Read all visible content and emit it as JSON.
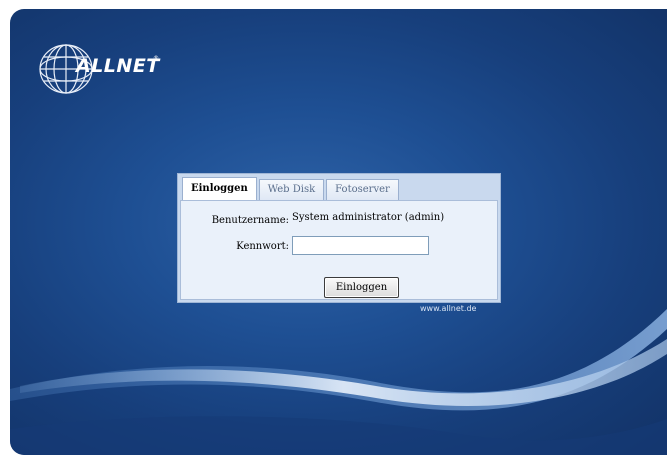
{
  "brand": {
    "name": "ALLNET",
    "registered": "®"
  },
  "login": {
    "tabs": [
      {
        "label": "Einloggen",
        "active": true
      },
      {
        "label": "Web Disk",
        "active": false
      },
      {
        "label": "Fotoserver",
        "active": false
      }
    ],
    "username_label": "Benutzername:",
    "username_value": "System administrator (admin)",
    "password_label": "Kennwort:",
    "password_value": "",
    "submit_label": "Einloggen"
  },
  "footer": {
    "url": "www.allnet.de"
  },
  "colors": {
    "background": "#1e4f93",
    "panel": "#c9d9ee",
    "form": "#eaf1fa"
  }
}
